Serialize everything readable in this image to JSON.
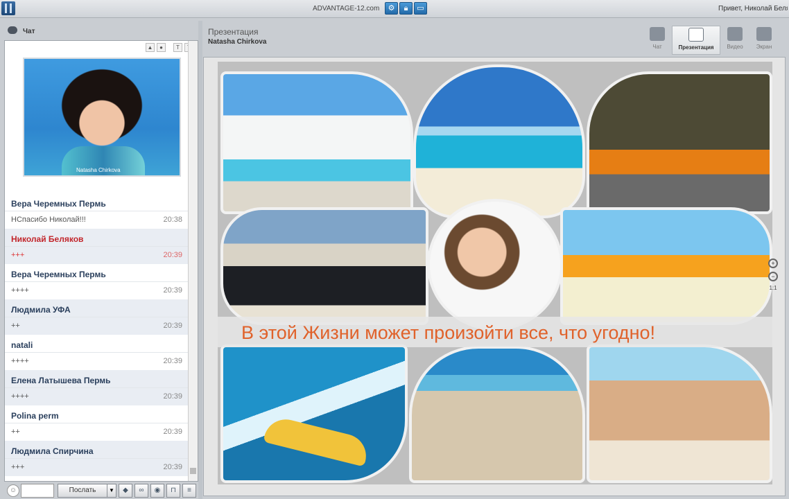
{
  "topbar": {
    "site": "ADVANTAGE-12.com",
    "buttons": [
      "gear-icon",
      "lock-icon",
      "window-icon"
    ],
    "greeting": "Привет, Николай Беляк"
  },
  "chat": {
    "title": "Чат",
    "avatar_caption": "Natasha Chirkova",
    "messages": [
      {
        "name": "Вера Черемных Пермь",
        "text": "НСпасибо Николай!!!",
        "time": "20:38",
        "highlight": false
      },
      {
        "name": "Николай Беляков",
        "text": "+++",
        "time": "20:39",
        "highlight": true
      },
      {
        "name": "Вера Черемных Пермь",
        "text": "++++",
        "time": "20:39",
        "highlight": false
      },
      {
        "name": "Людмила УФА",
        "text": "++",
        "time": "20:39",
        "highlight": false
      },
      {
        "name": "natali",
        "text": "++++",
        "time": "20:39",
        "highlight": false
      },
      {
        "name": "Елена Латышева Пермь",
        "text": "++++",
        "time": "20:39",
        "highlight": false
      },
      {
        "name": "Polina perm",
        "text": "++",
        "time": "20:39",
        "highlight": false
      },
      {
        "name": "Людмила Спирчина",
        "text": "+++",
        "time": "20:39",
        "highlight": false
      }
    ],
    "input": {
      "value": "",
      "send_label": "Послать"
    }
  },
  "presentation": {
    "title": "Презентация",
    "presenter": "Natasha Chirkova",
    "modes": [
      {
        "label": "Чат",
        "icon": "chat-icon",
        "active": false
      },
      {
        "label": "Презентация",
        "icon": "presentation-icon",
        "active": true
      },
      {
        "label": "Видео",
        "icon": "video-camera-icon",
        "active": false
      },
      {
        "label": "Экран",
        "icon": "screen-icon",
        "active": false
      }
    ],
    "slide_banner": "В этой Жизни может произойти все, что угодно!",
    "zoom_ratio": "1:1"
  }
}
